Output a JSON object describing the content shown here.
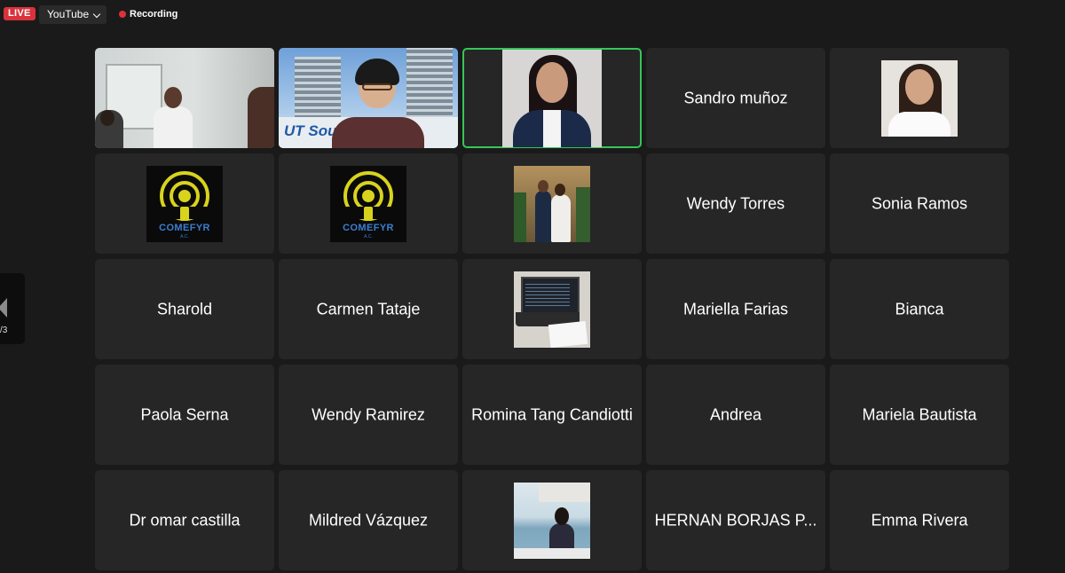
{
  "topbar": {
    "live_label": "LIVE",
    "platform": "YouTube",
    "recording_label": "Recording"
  },
  "pager": {
    "page_indicator": "/3"
  },
  "tiles": {
    "t4": "Sandro muñoz",
    "t9": "Wendy Torres",
    "t10": "Sonia Ramos",
    "t11": "Sharold",
    "t12": "Carmen Tataje",
    "t14": "Mariella Farias",
    "t15": "Bianca",
    "t16": "Paola Serna",
    "t17": "Wendy Ramirez",
    "t18": "Romina Tang Candiotti",
    "t19": "Andrea",
    "t20": "Mariela Bautista",
    "t21": "Dr omar castilla",
    "t22": "Mildred Vázquez",
    "t24": "HERNAN BORJAS P...",
    "t25": "Emma Rivera"
  },
  "logo": {
    "brand": "COMEFYR",
    "suffix": "A.C."
  },
  "video_sign_text": "UT South",
  "colors": {
    "live": "#d9323c",
    "active_speaker": "#35c659",
    "tile_bg": "#262626",
    "recording_dot": "#e0303a"
  }
}
